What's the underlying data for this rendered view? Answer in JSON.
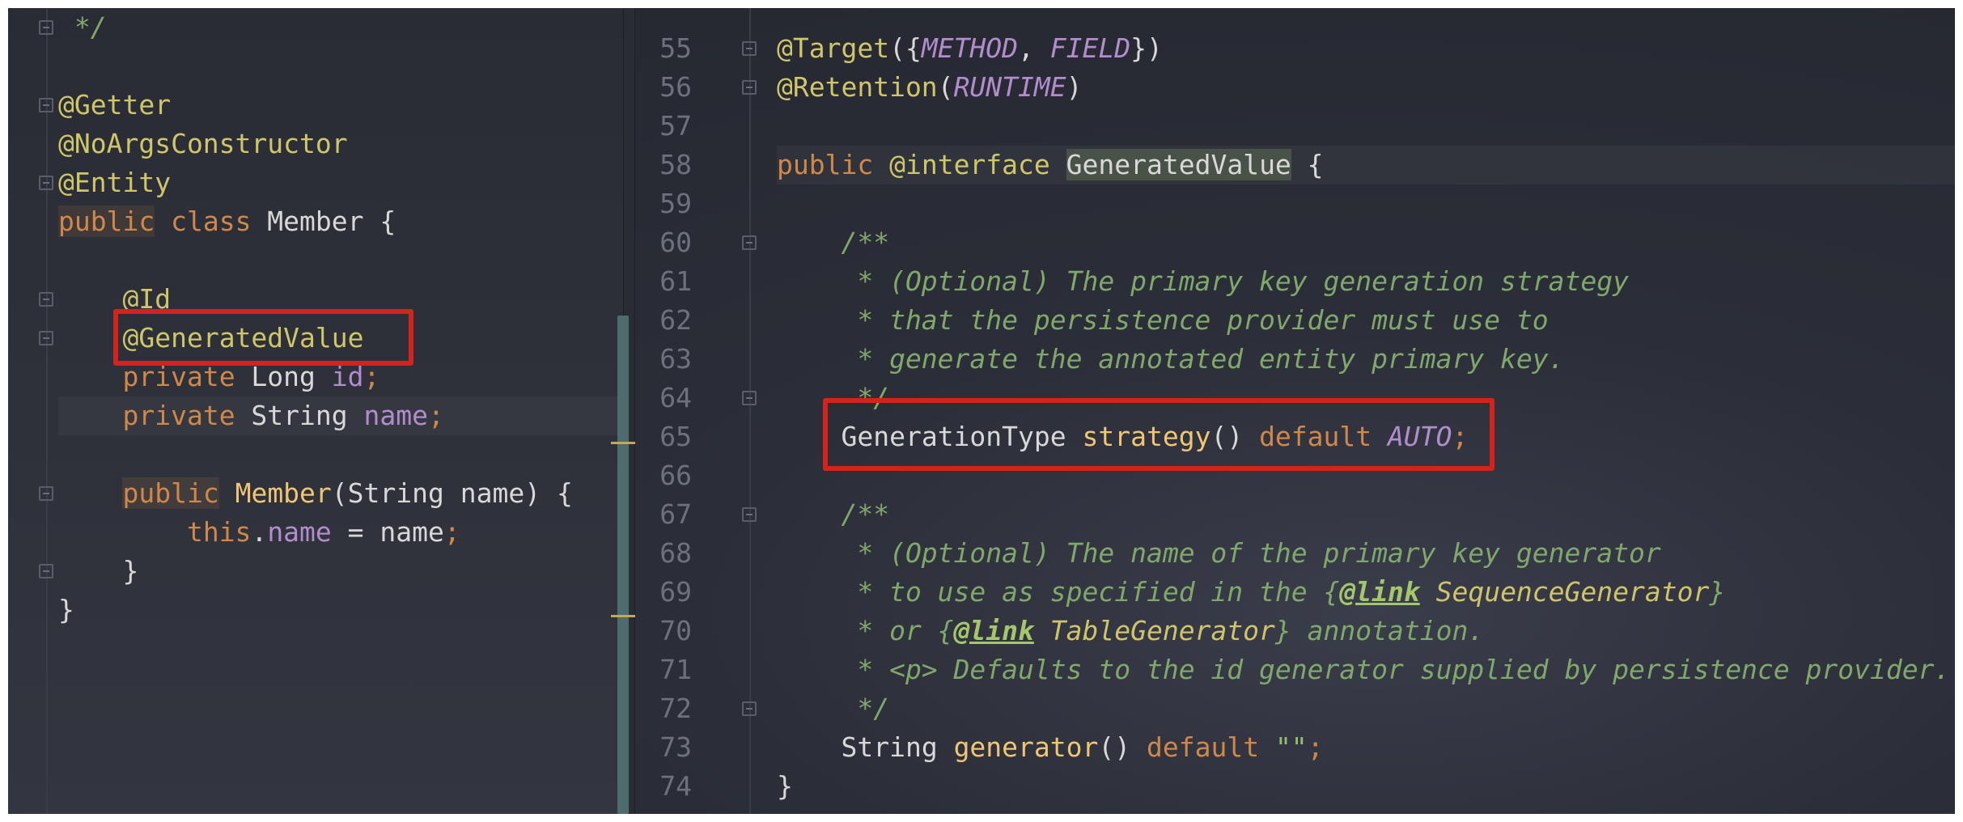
{
  "left_editor": {
    "lines": [
      {
        "segments": [
          {
            "cls": "cmt",
            "t": " */"
          }
        ]
      },
      {
        "segments": []
      },
      {
        "segments": [
          {
            "cls": "ann",
            "t": "@Getter"
          }
        ]
      },
      {
        "segments": [
          {
            "cls": "ann",
            "t": "@NoArgsConstructor"
          }
        ]
      },
      {
        "segments": [
          {
            "cls": "ann",
            "t": "@Entity"
          }
        ]
      },
      {
        "segments": [
          {
            "cls": "kw kwbg",
            "t": "public"
          },
          {
            "cls": "punc",
            "t": " "
          },
          {
            "cls": "kw",
            "t": "class"
          },
          {
            "cls": "cls",
            "t": " Member {"
          }
        ]
      },
      {
        "segments": []
      },
      {
        "segments": [
          {
            "cls": "punc",
            "t": "    "
          },
          {
            "cls": "ann",
            "t": "@Id"
          }
        ]
      },
      {
        "segments": [
          {
            "cls": "punc",
            "t": "    "
          },
          {
            "cls": "ann",
            "t": "@GeneratedValue"
          }
        ]
      },
      {
        "segments": [
          {
            "cls": "punc",
            "t": "    "
          },
          {
            "cls": "kw",
            "t": "private"
          },
          {
            "cls": "cls",
            "t": " Long "
          },
          {
            "cls": "fld",
            "t": "id"
          },
          {
            "cls": "kw",
            "t": ";"
          }
        ]
      },
      {
        "segments": [
          {
            "cls": "punc",
            "t": "    "
          },
          {
            "cls": "kw",
            "t": "private"
          },
          {
            "cls": "cls",
            "t": " String "
          },
          {
            "cls": "fld",
            "t": "name"
          },
          {
            "cls": "kw",
            "t": ";"
          }
        ]
      },
      {
        "segments": []
      },
      {
        "segments": [
          {
            "cls": "punc",
            "t": "    "
          },
          {
            "cls": "kw kwbg",
            "t": "public"
          },
          {
            "cls": "punc",
            "t": " "
          },
          {
            "cls": "fn",
            "t": "Member"
          },
          {
            "cls": "cls",
            "t": "(String name) {"
          }
        ]
      },
      {
        "segments": [
          {
            "cls": "punc",
            "t": "        "
          },
          {
            "cls": "kw",
            "t": "this"
          },
          {
            "cls": "punc",
            "t": "."
          },
          {
            "cls": "fld",
            "t": "name"
          },
          {
            "cls": "cls",
            "t": " = name"
          },
          {
            "cls": "kw",
            "t": ";"
          }
        ]
      },
      {
        "segments": [
          {
            "cls": "punc",
            "t": "    }"
          }
        ]
      },
      {
        "segments": [
          {
            "cls": "punc",
            "t": "}"
          }
        ]
      }
    ]
  },
  "right_editor": {
    "lines": [
      {
        "num": "55",
        "segments": [
          {
            "cls": "ann",
            "t": "@Target"
          },
          {
            "cls": "punc",
            "t": "({"
          },
          {
            "cls": "cst",
            "t": "METHOD"
          },
          {
            "cls": "punc",
            "t": ", "
          },
          {
            "cls": "cst",
            "t": "FIELD"
          },
          {
            "cls": "punc",
            "t": "})"
          }
        ]
      },
      {
        "num": "56",
        "segments": [
          {
            "cls": "ann",
            "t": "@Retention"
          },
          {
            "cls": "punc",
            "t": "("
          },
          {
            "cls": "cst",
            "t": "RUNTIME"
          },
          {
            "cls": "punc",
            "t": ")"
          }
        ]
      },
      {
        "num": "57",
        "segments": []
      },
      {
        "num": "58",
        "segments": [
          {
            "cls": "kw",
            "t": "public"
          },
          {
            "cls": "punc",
            "t": " "
          },
          {
            "cls": "ann",
            "t": "@interface"
          },
          {
            "cls": "punc",
            "t": " "
          },
          {
            "cls": "cls hl",
            "t": "GeneratedValue"
          },
          {
            "cls": "punc",
            "t": " {"
          }
        ]
      },
      {
        "num": "59",
        "segments": []
      },
      {
        "num": "60",
        "segments": [
          {
            "cls": "cmt",
            "t": "    /**"
          }
        ]
      },
      {
        "num": "61",
        "segments": [
          {
            "cls": "cmt",
            "t": "     * (Optional) The primary key generation strategy"
          }
        ]
      },
      {
        "num": "62",
        "segments": [
          {
            "cls": "cmt",
            "t": "     * that the persistence provider must use to"
          }
        ]
      },
      {
        "num": "63",
        "segments": [
          {
            "cls": "cmt",
            "t": "     * generate the annotated entity primary key."
          }
        ]
      },
      {
        "num": "64",
        "segments": [
          {
            "cls": "cmt",
            "t": "     */"
          }
        ]
      },
      {
        "num": "65",
        "segments": [
          {
            "cls": "punc",
            "t": "    "
          },
          {
            "cls": "cls",
            "t": "GenerationType "
          },
          {
            "cls": "fn",
            "t": "strategy"
          },
          {
            "cls": "punc",
            "t": "() "
          },
          {
            "cls": "kw",
            "t": "default"
          },
          {
            "cls": "punc",
            "t": " "
          },
          {
            "cls": "cst",
            "t": "AUTO"
          },
          {
            "cls": "kw",
            "t": ";"
          }
        ]
      },
      {
        "num": "66",
        "segments": []
      },
      {
        "num": "67",
        "segments": [
          {
            "cls": "cmt",
            "t": "    /**"
          }
        ]
      },
      {
        "num": "68",
        "segments": [
          {
            "cls": "cmt",
            "t": "     * (Optional) The name of the primary key generator"
          }
        ]
      },
      {
        "num": "69",
        "segments": [
          {
            "cls": "cmt",
            "t": "     * to use as specified in the {"
          },
          {
            "cls": "cmtb",
            "t": "@link"
          },
          {
            "cls": "cmt",
            "t": " "
          },
          {
            "cls": "cmtc",
            "t": "SequenceGenerator"
          },
          {
            "cls": "cmt",
            "t": "}"
          }
        ]
      },
      {
        "num": "70",
        "segments": [
          {
            "cls": "cmt",
            "t": "     * or {"
          },
          {
            "cls": "cmtb",
            "t": "@link"
          },
          {
            "cls": "cmt",
            "t": " "
          },
          {
            "cls": "cmtc",
            "t": "TableGenerator"
          },
          {
            "cls": "cmt",
            "t": "} annotation."
          }
        ]
      },
      {
        "num": "71",
        "segments": [
          {
            "cls": "cmt",
            "t": "     * <p> Defaults to the id generator supplied by persistence provider."
          }
        ]
      },
      {
        "num": "72",
        "segments": [
          {
            "cls": "cmt",
            "t": "     */"
          }
        ]
      },
      {
        "num": "73",
        "segments": [
          {
            "cls": "punc",
            "t": "    "
          },
          {
            "cls": "cls",
            "t": "String "
          },
          {
            "cls": "fn",
            "t": "generator"
          },
          {
            "cls": "punc",
            "t": "() "
          },
          {
            "cls": "kw",
            "t": "default"
          },
          {
            "cls": "punc",
            "t": " "
          },
          {
            "cls": "str",
            "t": "\"\""
          },
          {
            "cls": "kw",
            "t": ";"
          }
        ]
      },
      {
        "num": "74",
        "segments": [
          {
            "cls": "punc",
            "t": "}"
          }
        ]
      }
    ]
  },
  "colors": {
    "annotation": "#cfc66a",
    "keyword": "#d0884a",
    "comment": "#7fa86a",
    "constant": "#b28ccc",
    "highlight_box": "#d4231c"
  },
  "highlights": [
    "@GeneratedValue",
    "GenerationType strategy() default AUTO;"
  ]
}
